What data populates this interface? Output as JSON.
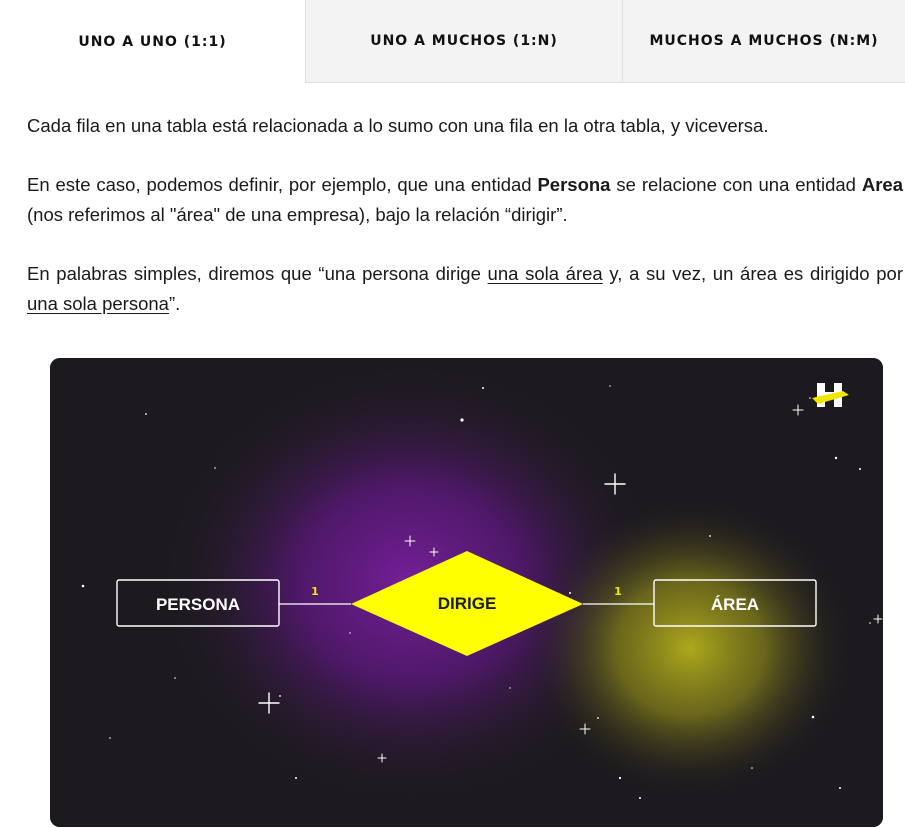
{
  "tabs": [
    {
      "label": "UNO A UNO (1:1)"
    },
    {
      "label": "UNO A MUCHOS (1:N)"
    },
    {
      "label": "MUCHOS A MUCHOS (N:M)"
    }
  ],
  "paragraphs": {
    "p1": "Cada fila en una tabla está relacionada a lo sumo con una fila en la otra tabla, y viceversa.",
    "p2": {
      "t1": "En este caso, podemos definir, por ejemplo, que una entidad ",
      "b1": "Persona",
      "t2": " se relacione con una entidad ",
      "b2": "Area",
      "t3": " (nos referimos al \"área\" de una empresa), bajo la relación “dirigir”."
    },
    "p3": {
      "t1": "En palabras simples, diremos que “una persona dirige ",
      "u1": "una sola área",
      "t2": " y, a su vez, un área es dirigido por ",
      "u2": "una sola persona",
      "t3": "”."
    }
  },
  "diagram": {
    "entity_left": "PERSONA",
    "relation": "DIRIGE",
    "entity_right": "ÁREA",
    "cardinality_left": "1",
    "cardinality_right": "1",
    "logo_icon": "logo-h-icon",
    "colors": {
      "background": "#1d1a1f",
      "accent_yellow": "#ffff00",
      "glow_purple": "#7a1f9a",
      "glow_yellow": "#b8b31a"
    }
  }
}
